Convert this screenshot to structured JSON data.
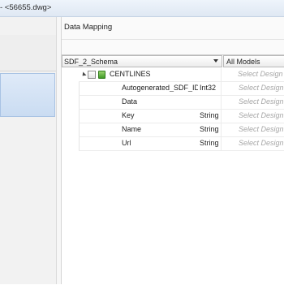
{
  "window": {
    "title": "- <56655.dwg>"
  },
  "panel": {
    "title": "Data Mapping"
  },
  "toolbar": {
    "schema": "SDF_2_Schema",
    "models": "All Models"
  },
  "class_row": {
    "name": "CENTLINES",
    "select": "Select Design"
  },
  "fields": [
    {
      "name": "Autogenerated_SDF_ID",
      "type": "Int32",
      "select": "Select Design"
    },
    {
      "name": "Data",
      "type": "",
      "select": "Select Design"
    },
    {
      "name": "Key",
      "type": "String",
      "select": "Select Design"
    },
    {
      "name": "Name",
      "type": "String",
      "select": "Select Design"
    },
    {
      "name": "Url",
      "type": "String",
      "select": "Select Design"
    }
  ],
  "colors": {
    "selection": "#cadcf2",
    "feature_icon": "#3f9a27"
  },
  "icons": {
    "expand": "expand-triangle-icon",
    "feature_class": "feature-class-icon"
  }
}
